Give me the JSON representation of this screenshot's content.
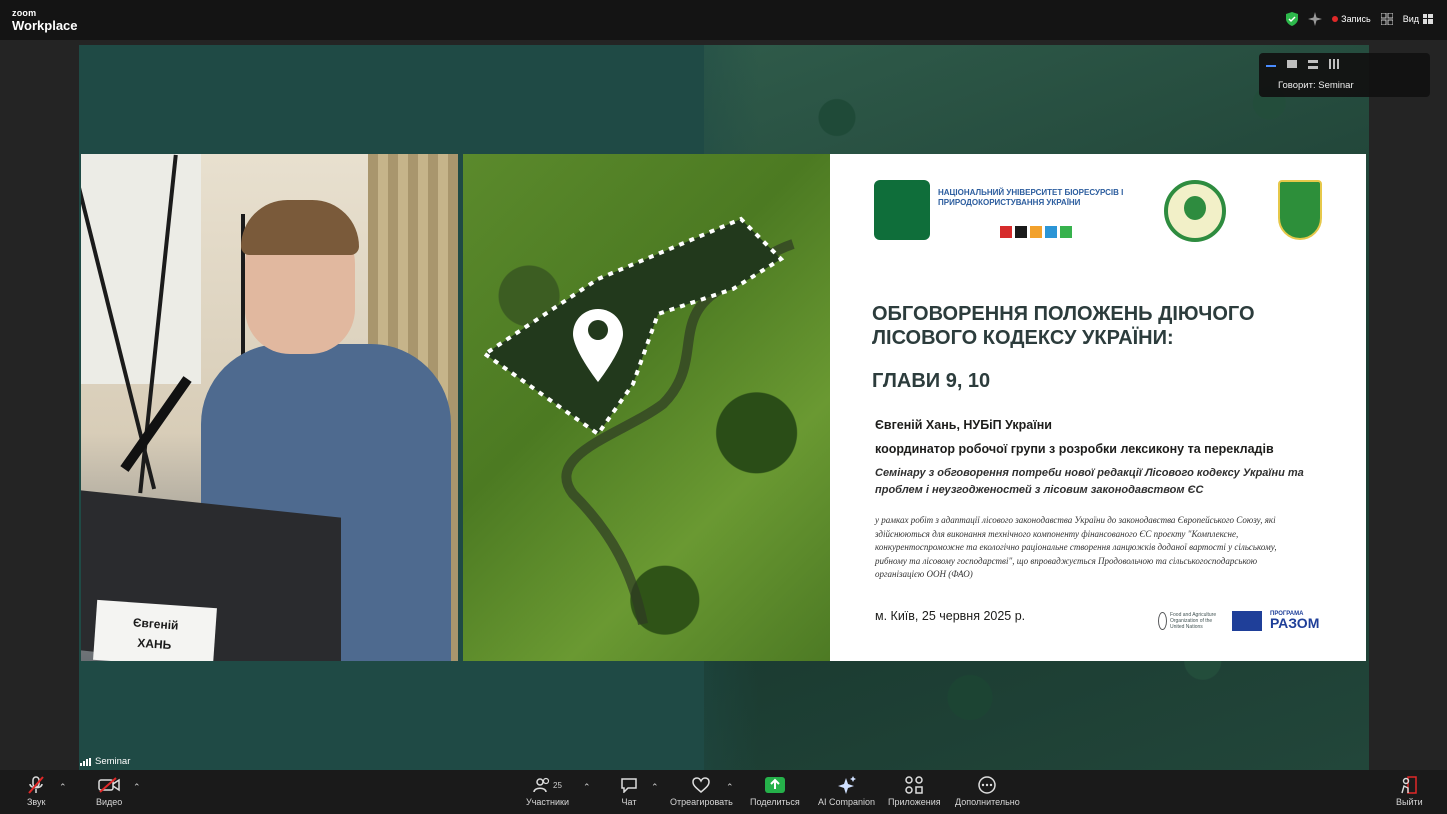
{
  "app": {
    "brand_top": "zoom",
    "brand_bottom": "Workplace"
  },
  "topbar": {
    "record_label": "Запись",
    "view_label": "Вид"
  },
  "speaking_overlay": {
    "label": "Говорит: Seminar"
  },
  "participant": {
    "name": "Seminar"
  },
  "speaker_video": {
    "nameplate_line1": "Євгеній",
    "nameplate_line2": "ХАНЬ"
  },
  "slide": {
    "university": "Національний університет біоресурсів і природокористування України",
    "title": "ОБГОВОРЕННЯ ПОЛОЖЕНЬ ДІЮЧОГО ЛІСОВОГО КОДЕКСУ УКРАЇНИ:",
    "chapters": "ГЛАВИ 9, 10",
    "author": "Євгеній Хань, НУБіП України",
    "role": "координатор робочої групи з розробки лексикону та перекладів",
    "seminar": "Семінару з обговорення потреби нової редакції Лісового кодексу України та проблем і неузгодженостей з лісовим законодавством ЄС",
    "context": "у рамках робіт з адаптації лісового законодавства України до законодавства Європейського Союзу, які здійснюються для виконання технічного компоненту фінансованого ЄС проєкту \"Комплексне, конкурентоспроможне та екологічно раціональне створення ланцюжків доданої вартості у сільському, рибному та лісовому господарстві\", що впроваджується Продовольчою та сільськогосподарською організацією ООН (ФАО)",
    "place_date": "м. Київ, 25 червня 2025 р.",
    "fao_caption": "Food and Agriculture Organization of the United Nations",
    "razom_small": "ПРОГРАМА",
    "razom": "РАЗОМ"
  },
  "toolbar": {
    "audio": "Звук",
    "video": "Видео",
    "participants": "Участники",
    "participants_count": "25",
    "chat": "Чат",
    "react": "Отреагировать",
    "share": "Поделиться",
    "ai": "AI Companion",
    "apps": "Приложения",
    "more": "Дополнительно",
    "leave": "Выйти"
  },
  "colors": {
    "share_green": "#25b14a",
    "record_red": "#e02828",
    "active_blue": "#4a8cff"
  },
  "icons": [
    "shield-icon",
    "sparkle-icon",
    "grid-icon",
    "mic-muted-icon",
    "video-muted-icon",
    "participants-icon",
    "chat-icon",
    "heart-icon",
    "share-screen-icon",
    "ai-companion-icon",
    "apps-icon",
    "more-icon",
    "leave-icon"
  ]
}
